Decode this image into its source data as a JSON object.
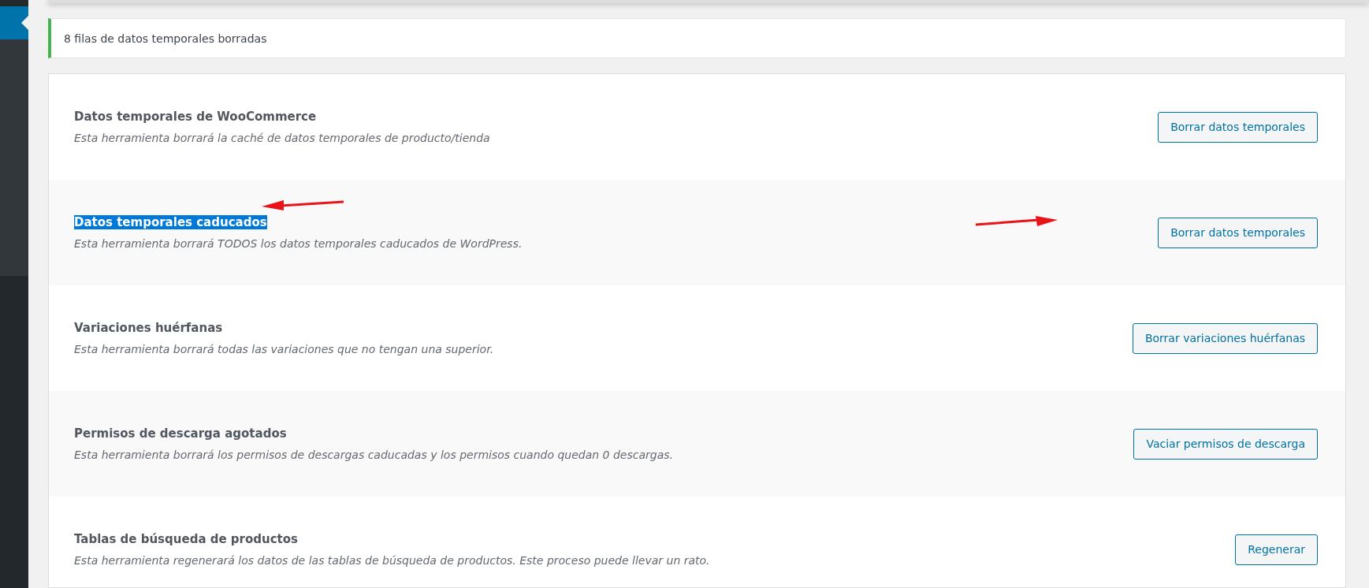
{
  "notice": {
    "text": "8 filas de datos temporales borradas"
  },
  "tools": [
    {
      "title": "Datos temporales de WooCommerce",
      "description": "Esta herramienta borrará la caché de datos temporales de producto/tienda",
      "button": "Borrar datos temporales",
      "highlighted": false,
      "arrows": false
    },
    {
      "title": "Datos temporales caducados",
      "description": "Esta herramienta borrará TODOS los datos temporales caducados de WordPress.",
      "button": "Borrar datos temporales",
      "highlighted": true,
      "arrows": true
    },
    {
      "title": "Variaciones huérfanas",
      "description": "Esta herramienta borrará todas las variaciones que no tengan una superior.",
      "button": "Borrar variaciones huérfanas",
      "highlighted": false,
      "arrows": false
    },
    {
      "title": "Permisos de descarga agotados",
      "description": "Esta herramienta borrará los permisos de descargas caducadas y los permisos cuando quedan 0 descargas.",
      "button": "Vaciar permisos de descarga",
      "highlighted": false,
      "arrows": false
    },
    {
      "title": "Tablas de búsqueda de productos",
      "description": "Esta herramienta regenerará los datos de las tablas de búsqueda de productos. Este proceso puede llevar un rato.",
      "button": "Regenerar",
      "highlighted": false,
      "arrows": false
    }
  ]
}
